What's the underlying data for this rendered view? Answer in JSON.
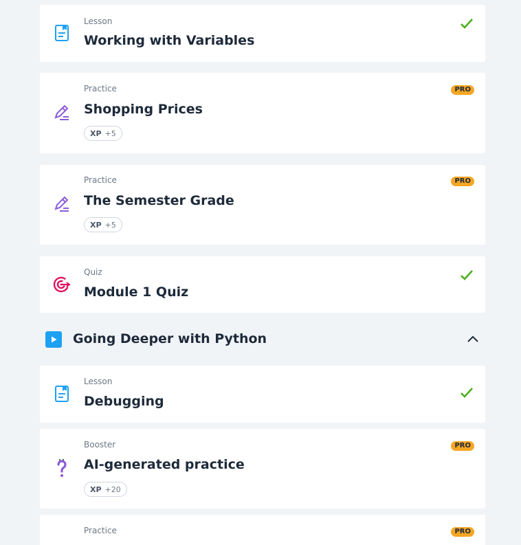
{
  "colors": {
    "lesson_icon": "#1da1f2",
    "practice_icon": "#8b5cd6",
    "quiz_icon": "#e0115f",
    "check": "#4caf1a",
    "pro_badge": "#f5a623",
    "background": "#f1f4f7"
  },
  "items": [
    {
      "type": "Lesson",
      "title": "Working with Variables",
      "icon": "lesson-icon",
      "completed": true
    },
    {
      "type": "Practice",
      "title": "Shopping Prices",
      "icon": "practice-pencil-icon",
      "pro": "PRO",
      "xp_label": "XP",
      "xp_value": "+5"
    },
    {
      "type": "Practice",
      "title": "The Semester Grade",
      "icon": "practice-pencil-icon",
      "pro": "PRO",
      "xp_label": "XP",
      "xp_value": "+5"
    },
    {
      "type": "Quiz",
      "title": "Module 1 Quiz",
      "icon": "target-icon",
      "completed": true
    }
  ],
  "section": {
    "title": "Going Deeper with Python",
    "icon": "play-icon",
    "expanded": true
  },
  "section_items": [
    {
      "type": "Lesson",
      "title": "Debugging",
      "icon": "lesson-icon",
      "completed": true
    },
    {
      "type": "Booster",
      "title": "AI-generated practice",
      "icon": "question-icon",
      "pro": "PRO",
      "xp_label": "XP",
      "xp_value": "+20"
    },
    {
      "type": "Practice",
      "pro": "PRO"
    }
  ]
}
